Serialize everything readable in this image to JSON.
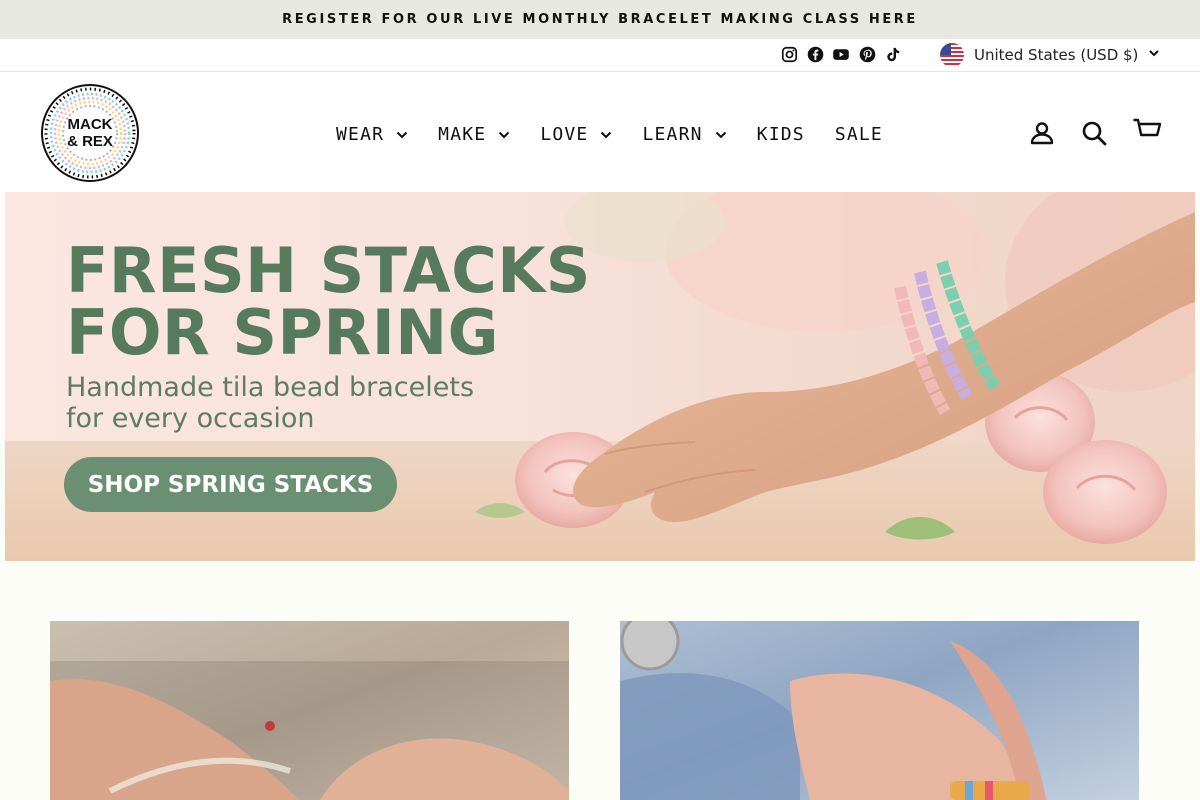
{
  "announcement": {
    "text": "REGISTER FOR OUR LIVE MONTHLY BRACELET MAKING CLASS HERE"
  },
  "utility": {
    "socials": [
      "instagram-icon",
      "facebook-icon",
      "youtube-icon",
      "pinterest-icon",
      "tiktok-icon"
    ],
    "currency_label": "United States (USD $)"
  },
  "header": {
    "logo_text_line1": "MACK",
    "logo_text_line2": "& REX",
    "nav": [
      {
        "label": "WEAR",
        "has_dropdown": true
      },
      {
        "label": "MAKE",
        "has_dropdown": true
      },
      {
        "label": "LOVE",
        "has_dropdown": true
      },
      {
        "label": "LEARN",
        "has_dropdown": true
      },
      {
        "label": "KIDS",
        "has_dropdown": false
      },
      {
        "label": "SALE",
        "has_dropdown": false
      }
    ],
    "icons": [
      "account-icon",
      "search-icon",
      "cart-icon"
    ]
  },
  "hero": {
    "title_line1": "FRESH STACKS",
    "title_line2": "FOR SPRING",
    "subtitle_line1": "Handmade tila bead bracelets",
    "subtitle_line2": "for every occasion",
    "cta_label": "SHOP SPRING STACKS"
  },
  "colors": {
    "announcement_bg": "#e8e8e2",
    "hero_title": "#567a5c",
    "cta_bg": "#6a8f72",
    "page_bg": "#fdfdf7"
  }
}
